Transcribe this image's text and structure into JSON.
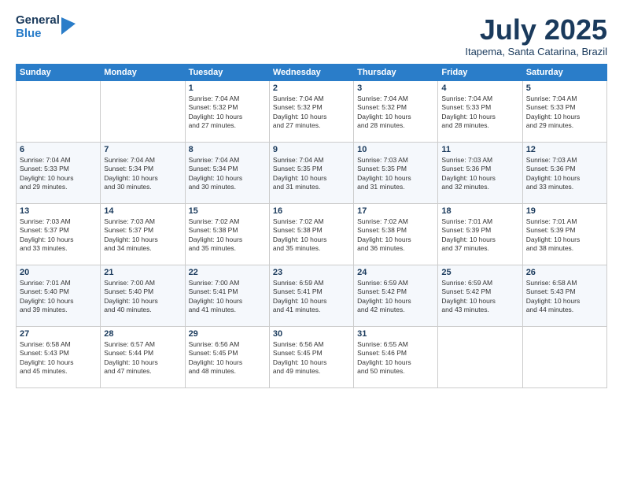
{
  "header": {
    "logo_general": "General",
    "logo_blue": "Blue",
    "month_title": "July 2025",
    "subtitle": "Itapema, Santa Catarina, Brazil"
  },
  "days_of_week": [
    "Sunday",
    "Monday",
    "Tuesday",
    "Wednesday",
    "Thursday",
    "Friday",
    "Saturday"
  ],
  "weeks": [
    [
      {
        "day": "",
        "info": ""
      },
      {
        "day": "",
        "info": ""
      },
      {
        "day": "1",
        "info": "Sunrise: 7:04 AM\nSunset: 5:32 PM\nDaylight: 10 hours\nand 27 minutes."
      },
      {
        "day": "2",
        "info": "Sunrise: 7:04 AM\nSunset: 5:32 PM\nDaylight: 10 hours\nand 27 minutes."
      },
      {
        "day": "3",
        "info": "Sunrise: 7:04 AM\nSunset: 5:32 PM\nDaylight: 10 hours\nand 28 minutes."
      },
      {
        "day": "4",
        "info": "Sunrise: 7:04 AM\nSunset: 5:33 PM\nDaylight: 10 hours\nand 28 minutes."
      },
      {
        "day": "5",
        "info": "Sunrise: 7:04 AM\nSunset: 5:33 PM\nDaylight: 10 hours\nand 29 minutes."
      }
    ],
    [
      {
        "day": "6",
        "info": "Sunrise: 7:04 AM\nSunset: 5:33 PM\nDaylight: 10 hours\nand 29 minutes."
      },
      {
        "day": "7",
        "info": "Sunrise: 7:04 AM\nSunset: 5:34 PM\nDaylight: 10 hours\nand 30 minutes."
      },
      {
        "day": "8",
        "info": "Sunrise: 7:04 AM\nSunset: 5:34 PM\nDaylight: 10 hours\nand 30 minutes."
      },
      {
        "day": "9",
        "info": "Sunrise: 7:04 AM\nSunset: 5:35 PM\nDaylight: 10 hours\nand 31 minutes."
      },
      {
        "day": "10",
        "info": "Sunrise: 7:03 AM\nSunset: 5:35 PM\nDaylight: 10 hours\nand 31 minutes."
      },
      {
        "day": "11",
        "info": "Sunrise: 7:03 AM\nSunset: 5:36 PM\nDaylight: 10 hours\nand 32 minutes."
      },
      {
        "day": "12",
        "info": "Sunrise: 7:03 AM\nSunset: 5:36 PM\nDaylight: 10 hours\nand 33 minutes."
      }
    ],
    [
      {
        "day": "13",
        "info": "Sunrise: 7:03 AM\nSunset: 5:37 PM\nDaylight: 10 hours\nand 33 minutes."
      },
      {
        "day": "14",
        "info": "Sunrise: 7:03 AM\nSunset: 5:37 PM\nDaylight: 10 hours\nand 34 minutes."
      },
      {
        "day": "15",
        "info": "Sunrise: 7:02 AM\nSunset: 5:38 PM\nDaylight: 10 hours\nand 35 minutes."
      },
      {
        "day": "16",
        "info": "Sunrise: 7:02 AM\nSunset: 5:38 PM\nDaylight: 10 hours\nand 35 minutes."
      },
      {
        "day": "17",
        "info": "Sunrise: 7:02 AM\nSunset: 5:38 PM\nDaylight: 10 hours\nand 36 minutes."
      },
      {
        "day": "18",
        "info": "Sunrise: 7:01 AM\nSunset: 5:39 PM\nDaylight: 10 hours\nand 37 minutes."
      },
      {
        "day": "19",
        "info": "Sunrise: 7:01 AM\nSunset: 5:39 PM\nDaylight: 10 hours\nand 38 minutes."
      }
    ],
    [
      {
        "day": "20",
        "info": "Sunrise: 7:01 AM\nSunset: 5:40 PM\nDaylight: 10 hours\nand 39 minutes."
      },
      {
        "day": "21",
        "info": "Sunrise: 7:00 AM\nSunset: 5:40 PM\nDaylight: 10 hours\nand 40 minutes."
      },
      {
        "day": "22",
        "info": "Sunrise: 7:00 AM\nSunset: 5:41 PM\nDaylight: 10 hours\nand 41 minutes."
      },
      {
        "day": "23",
        "info": "Sunrise: 6:59 AM\nSunset: 5:41 PM\nDaylight: 10 hours\nand 41 minutes."
      },
      {
        "day": "24",
        "info": "Sunrise: 6:59 AM\nSunset: 5:42 PM\nDaylight: 10 hours\nand 42 minutes."
      },
      {
        "day": "25",
        "info": "Sunrise: 6:59 AM\nSunset: 5:42 PM\nDaylight: 10 hours\nand 43 minutes."
      },
      {
        "day": "26",
        "info": "Sunrise: 6:58 AM\nSunset: 5:43 PM\nDaylight: 10 hours\nand 44 minutes."
      }
    ],
    [
      {
        "day": "27",
        "info": "Sunrise: 6:58 AM\nSunset: 5:43 PM\nDaylight: 10 hours\nand 45 minutes."
      },
      {
        "day": "28",
        "info": "Sunrise: 6:57 AM\nSunset: 5:44 PM\nDaylight: 10 hours\nand 47 minutes."
      },
      {
        "day": "29",
        "info": "Sunrise: 6:56 AM\nSunset: 5:45 PM\nDaylight: 10 hours\nand 48 minutes."
      },
      {
        "day": "30",
        "info": "Sunrise: 6:56 AM\nSunset: 5:45 PM\nDaylight: 10 hours\nand 49 minutes."
      },
      {
        "day": "31",
        "info": "Sunrise: 6:55 AM\nSunset: 5:46 PM\nDaylight: 10 hours\nand 50 minutes."
      },
      {
        "day": "",
        "info": ""
      },
      {
        "day": "",
        "info": ""
      }
    ]
  ]
}
